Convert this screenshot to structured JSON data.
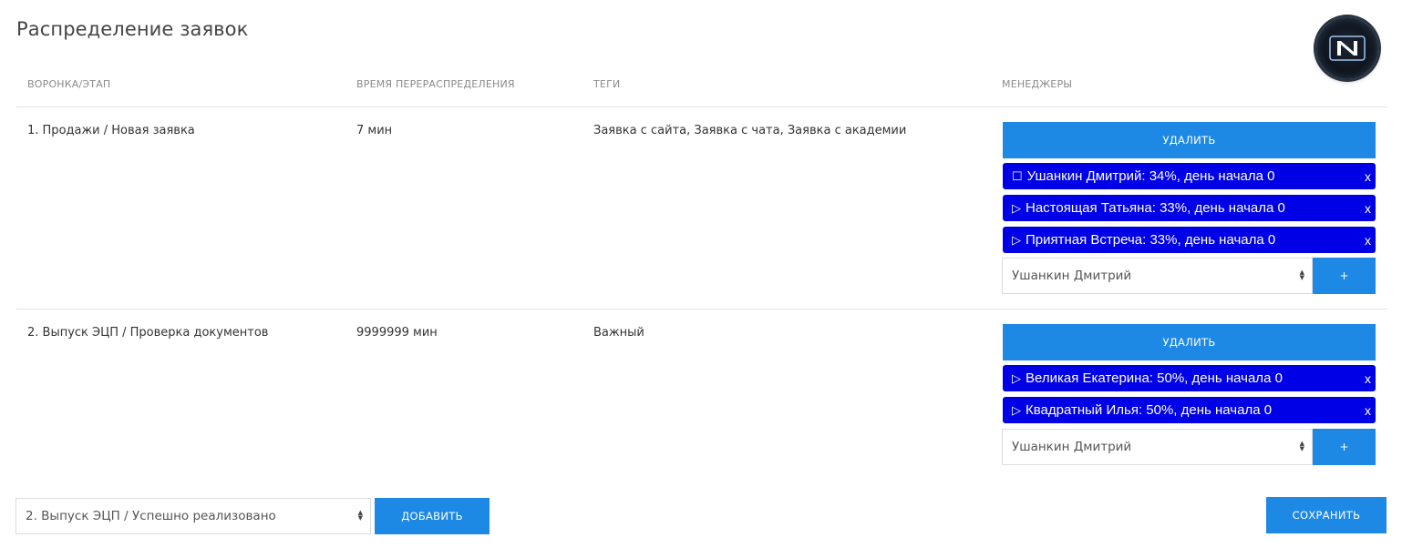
{
  "page": {
    "title": "Распределение заявок"
  },
  "logo": {
    "icon": "n-logo-icon"
  },
  "table": {
    "columns": [
      "Воронка/этап",
      "Время перераспределения",
      "Теги",
      "Менеджеры"
    ],
    "rows": [
      {
        "stage": "1. Продажи / Новая заявка",
        "time": "7 мин",
        "tags": "Заявка с сайта, Заявка с чата, Заявка с академии",
        "delete_label": "Удалить",
        "managers": [
          {
            "prefix": "☐",
            "text": "Ушанкин Дмитрий: 34%, день начала 0",
            "remove": "x"
          },
          {
            "prefix": "▷",
            "text": "Настоящая Татьяна: 33%, день начала 0",
            "remove": "x"
          },
          {
            "prefix": "▷",
            "text": "Приятная Встреча: 33%, день начала 0",
            "remove": "x"
          }
        ],
        "select_value": "Ушанкин Дмитрий",
        "add_label": "+"
      },
      {
        "stage": "2. Выпуск ЭЦП / Проверка документов",
        "time": "9999999 мин",
        "tags": "Важный",
        "delete_label": "Удалить",
        "managers": [
          {
            "prefix": "▷",
            "text": "Великая Екатерина: 50%, день начала 0",
            "remove": "x"
          },
          {
            "prefix": "▷",
            "text": "Квадратный Илья: 50%, день начала 0",
            "remove": "x"
          }
        ],
        "select_value": "Ушанкин Дмитрий",
        "add_label": "+"
      }
    ]
  },
  "footer": {
    "stage_select_value": "2. Выпуск ЭЦП / Успешно реализовано",
    "add_label": "Добавить",
    "save_label": "Сохранить"
  },
  "colors": {
    "accent": "#1e88e5",
    "manager_chip": "#0000e6"
  }
}
